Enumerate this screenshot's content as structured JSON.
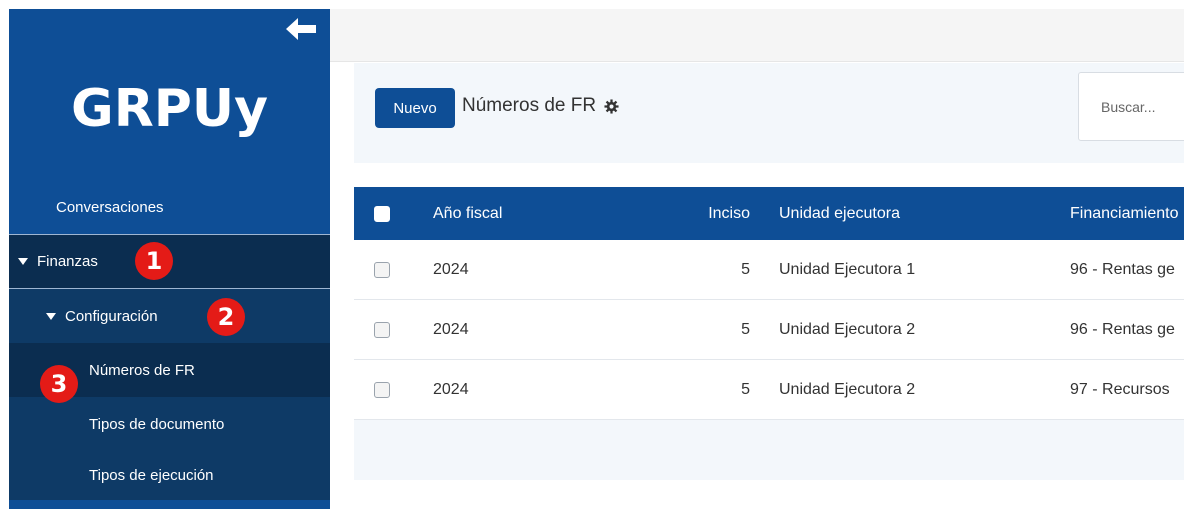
{
  "sidebar": {
    "logo": "GRPUy",
    "items": [
      {
        "label": "Conversaciones"
      },
      {
        "label": "Finanzas"
      },
      {
        "label": "Configuración"
      },
      {
        "label": "Números de FR"
      },
      {
        "label": "Tipos de documento"
      },
      {
        "label": "Tipos de ejecución"
      }
    ]
  },
  "badges": [
    "1",
    "2",
    "3"
  ],
  "toolbar": {
    "new_label": "Nuevo",
    "title": "Números de FR",
    "search_placeholder": "Buscar..."
  },
  "table": {
    "headers": [
      "Año fiscal",
      "Inciso",
      "Unidad ejecutora",
      "Financiamiento"
    ],
    "rows": [
      {
        "year": "2024",
        "inciso": "5",
        "unidad": "Unidad Ejecutora 1",
        "financiamiento": "96 - Rentas ge"
      },
      {
        "year": "2024",
        "inciso": "5",
        "unidad": "Unidad Ejecutora 2",
        "financiamiento": "96 - Rentas ge"
      },
      {
        "year": "2024",
        "inciso": "5",
        "unidad": "Unidad Ejecutora 2",
        "financiamiento": "97 - Recursos"
      }
    ]
  },
  "colors": {
    "brand": "#0e4e96",
    "sidebar_dark": "#0b2d50",
    "sidebar_mid": "#0e3a66",
    "badge": "#e41b17"
  }
}
